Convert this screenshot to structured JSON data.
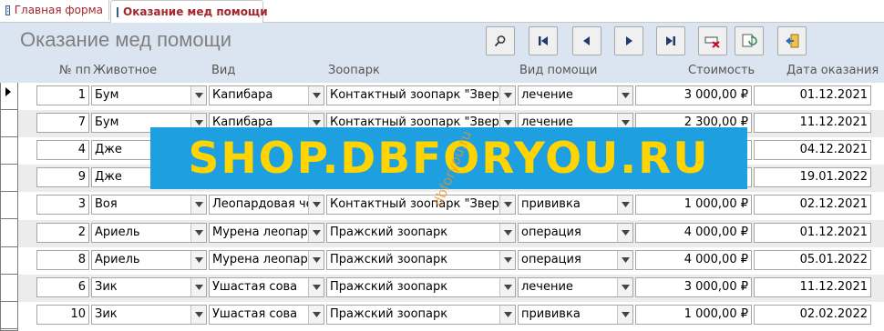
{
  "tabs": [
    {
      "label": "Главная форма",
      "icon": "form-icon"
    },
    {
      "label": "Оказание мед помощи",
      "icon": "form-icon"
    }
  ],
  "form": {
    "title": "Оказание мед помощи"
  },
  "toolbar": [
    "search-icon",
    "first-record-icon",
    "previous-record-icon",
    "next-record-icon",
    "last-record-icon",
    "delete-record-icon",
    "refresh-icon",
    "close-form-icon"
  ],
  "columns": [
    "№ пп",
    "Животное",
    "Вид",
    "Зоопарк",
    "Вид помощи",
    "Стоимость",
    "Дата оказания"
  ],
  "rows": [
    {
      "n": "1",
      "animal": "Бум",
      "species": "Капибара",
      "zoo": "Контактный зоопарк \"Звероп",
      "aid": "лечение",
      "cost": "3 000,00 ₽",
      "date": "01.12.2021"
    },
    {
      "n": "7",
      "animal": "Бум",
      "species": "Капибара",
      "zoo": "Контактный зоопарк \"Звероп",
      "aid": "лечение",
      "cost": "2 300,00 ₽",
      "date": "11.12.2021"
    },
    {
      "n": "4",
      "animal": "Дже",
      "species": "",
      "zoo": "",
      "aid": "",
      "cost": "",
      "date": "04.12.2021"
    },
    {
      "n": "9",
      "animal": "Дже",
      "species": "",
      "zoo": "",
      "aid": "",
      "cost": "",
      "date": "19.01.2022"
    },
    {
      "n": "3",
      "animal": "Воя",
      "species": "Леопардовая чер",
      "zoo": "Контактный зоопарк \"Звероп",
      "aid": "прививка",
      "cost": "1 000,00 ₽",
      "date": "02.12.2021"
    },
    {
      "n": "2",
      "animal": "Ариель",
      "species": "Мурена леопард",
      "zoo": "Пражский зоопарк",
      "aid": "операция",
      "cost": "4 000,00 ₽",
      "date": "01.12.2021"
    },
    {
      "n": "8",
      "animal": "Ариель",
      "species": "Мурена леопард",
      "zoo": "Пражский зоопарк",
      "aid": "операция",
      "cost": "4 000,00 ₽",
      "date": "05.01.2022"
    },
    {
      "n": "6",
      "animal": "Зик",
      "species": "Ушастая сова",
      "zoo": "Пражский зоопарк",
      "aid": "лечение",
      "cost": "3 000,00 ₽",
      "date": "11.12.2021"
    },
    {
      "n": "10",
      "animal": "Зик",
      "species": "Ушастая сова",
      "zoo": "Пражский зоопарк",
      "aid": "прививка",
      "cost": "1 000,00 ₽",
      "date": "02.02.2022"
    }
  ],
  "watermark": {
    "banner": "SHOP.DBFORYOU.RU",
    "diagonal": "dbforyou.ru"
  },
  "colors": {
    "header_bg": "#dbe5f1",
    "alt_row": "#ececec",
    "tab_text": "#a4262c",
    "banner_bg": "#1e9fe0",
    "banner_text": "#ffd400"
  }
}
